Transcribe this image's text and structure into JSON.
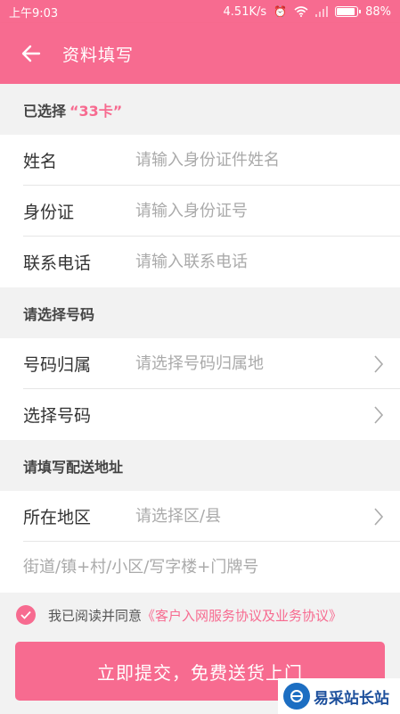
{
  "status_bar": {
    "time": "上午9:03",
    "network_speed": "4.51K/s",
    "battery": "88%"
  },
  "app_bar": {
    "title": "资料填写",
    "back_icon": "arrow-left-icon"
  },
  "selected": {
    "prefix": "已选择",
    "card_name": "“33卡”"
  },
  "personal_fields": [
    {
      "label": "姓名",
      "placeholder": "请输入身份证件姓名"
    },
    {
      "label": "身份证",
      "placeholder": "请输入身份证号"
    },
    {
      "label": "联系电话",
      "placeholder": "请输入联系电话"
    }
  ],
  "number_section": {
    "header": "请选择号码",
    "rows": [
      {
        "label": "号码归属",
        "placeholder": "请选择号码归属地"
      },
      {
        "label": "选择号码",
        "placeholder": ""
      }
    ]
  },
  "address_section": {
    "header": "请填写配送地址",
    "region_label": "所在地区",
    "region_placeholder": "请选择区/县",
    "street_placeholder": "街道/镇+村/小区/写字楼+门牌号"
  },
  "agreement": {
    "text": "我已阅读并同意",
    "link": "《客户入网服务协议及业务协议》",
    "checked": true
  },
  "submit_label": "立即提交，免费送货上门",
  "watermark": {
    "text": "易采站长站"
  },
  "colors": {
    "accent": "#f76b90",
    "background": "#f2f2f2"
  }
}
